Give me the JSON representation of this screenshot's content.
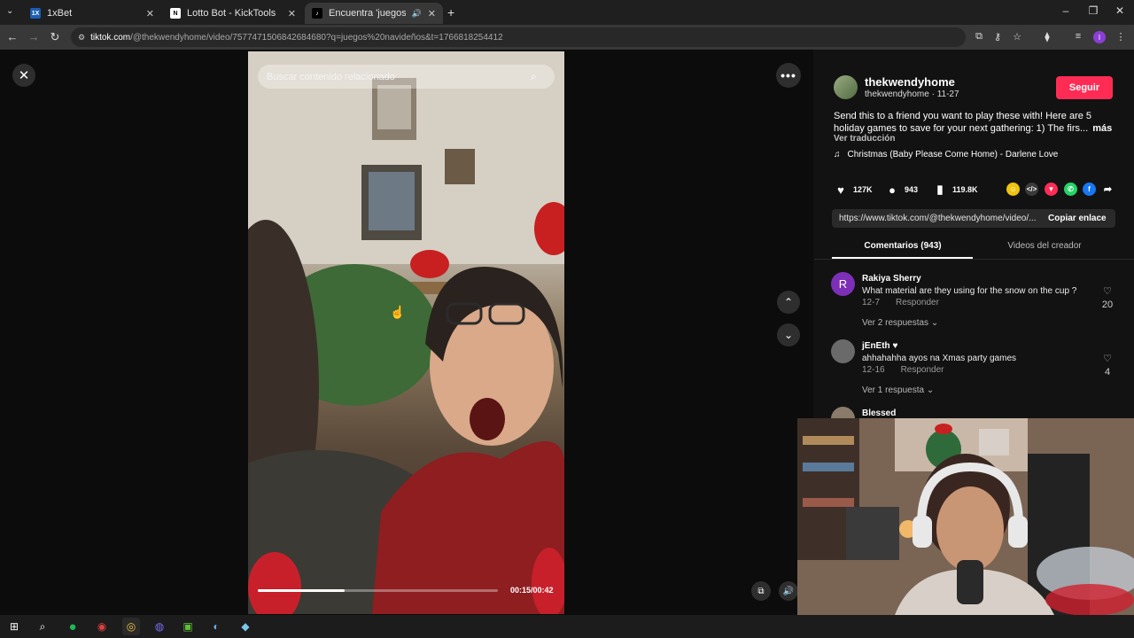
{
  "browser": {
    "tabs": [
      {
        "title": "1xBet",
        "icon": "1xbet-favicon",
        "active": false
      },
      {
        "title": "Lotto Bot - KickTools",
        "icon": "notion-favicon",
        "active": false
      },
      {
        "title": "Encuentra 'juegos navideñ",
        "icon": "tiktok-favicon",
        "active": true
      }
    ],
    "url_domain": "tiktok.com",
    "url_path": "/@thekwendyhome/video/7577471506842684680?q=juegos%20navideños&t=1766818254412"
  },
  "video": {
    "search_placeholder": "Buscar contenido relacionado",
    "time_label": "00:15/00:42",
    "progress_fraction": 0.36
  },
  "creator": {
    "username": "thekwendyhome",
    "subline": "thekwendyhome · 11-27",
    "follow_label": "Seguir",
    "description": "Send this to a friend you want to play these with! Here are 5 holiday games to save for your next gathering: 1) The firs...",
    "more_label": "más",
    "translate_label": "Ver traducción",
    "music": "Christmas (Baby Please Come Home) - Darlene Love"
  },
  "stats": {
    "likes": "127K",
    "comments": "943",
    "saves": "119.8K"
  },
  "link": {
    "url": "https://www.tiktok.com/@thekwendyhome/video/...",
    "copy_label": "Copiar enlace"
  },
  "panel_tabs": [
    {
      "label": "Comentarios (943)",
      "active": true
    },
    {
      "label": "Videos del creador",
      "active": false
    }
  ],
  "comments": [
    {
      "initial": "R",
      "name": "Rakiya Sherry",
      "text": "What material are they using for the snow on the cup ?",
      "date": "12-7",
      "reply_label": "Responder",
      "likes": "20",
      "replies_label": "Ver 2 respuestas ⌄"
    },
    {
      "initial": "",
      "name": "jEnEth ♥",
      "text": "ahhahahha ayos na Xmas party games",
      "date": "12-16",
      "reply_label": "Responder",
      "likes": "4",
      "replies_label": "Ver 1 respuesta ⌄"
    },
    {
      "initial": "",
      "name": "Blessed",
      "text": "",
      "date": "",
      "reply_label": "",
      "likes": "",
      "replies_label": ""
    }
  ],
  "colors": {
    "accent": "#fe2c55",
    "panel_bg": "#121212"
  }
}
